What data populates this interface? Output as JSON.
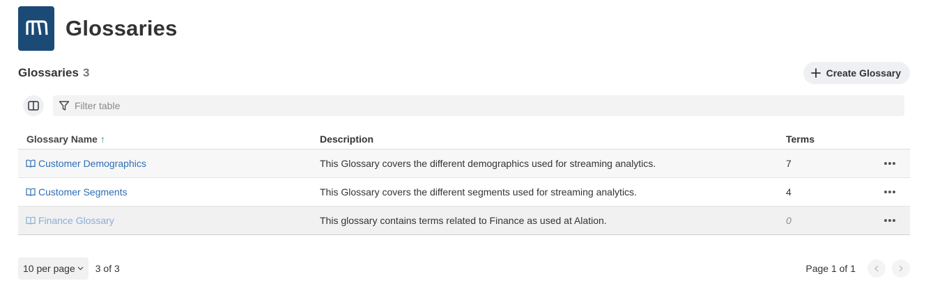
{
  "page": {
    "title": "Glossaries"
  },
  "section": {
    "title": "Glossaries",
    "count": "3",
    "create_label": "Create Glossary"
  },
  "toolbar": {
    "filter_placeholder": "Filter table"
  },
  "table": {
    "columns": {
      "name": "Glossary Name",
      "sort_indicator": "↑",
      "description": "Description",
      "terms": "Terms"
    },
    "rows": [
      {
        "name": "Customer Demographics",
        "description": "This Glossary covers the different demographics used for streaming analytics.",
        "terms": "7"
      },
      {
        "name": "Customer Segments",
        "description": "This Glossary covers the different segments used for streaming analytics.",
        "terms": "4"
      },
      {
        "name": "Finance Glossary",
        "description": "This glossary contains terms related to Finance as used at Alation.",
        "terms": "0"
      }
    ]
  },
  "pagination": {
    "per_page": "10 per page",
    "range": "3 of 3",
    "page": "Page 1 of 1"
  },
  "icons": {
    "logo": "alation-logo-icon",
    "plus": "plus-icon",
    "columns": "columns-icon",
    "filter": "filter-icon",
    "book": "book-icon",
    "more": "more-horizontal-icon",
    "chevron_down": "chevron-down-icon",
    "prev": "chevron-left-icon",
    "next": "chevron-right-icon"
  },
  "colors": {
    "brand": "#1b4a76",
    "link": "#2e6db4",
    "sort": "#1f9a8a"
  }
}
